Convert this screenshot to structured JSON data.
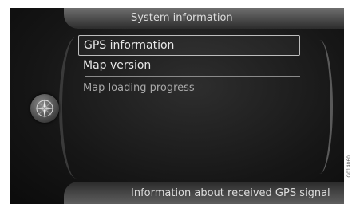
{
  "header": {
    "title": "System information"
  },
  "menu": {
    "items": [
      {
        "label": "GPS information",
        "selected": true
      },
      {
        "label": "Map version",
        "selected": false
      },
      {
        "label": "Map loading progress",
        "selected": false
      }
    ]
  },
  "footer": {
    "hint": "Information about received GPS signal"
  },
  "side_code": "G014060",
  "colors": {
    "background": "#161616",
    "header": "#5a5a5a",
    "text": "#e8e8e8"
  },
  "icons": {
    "emblem": "compass-icon"
  }
}
